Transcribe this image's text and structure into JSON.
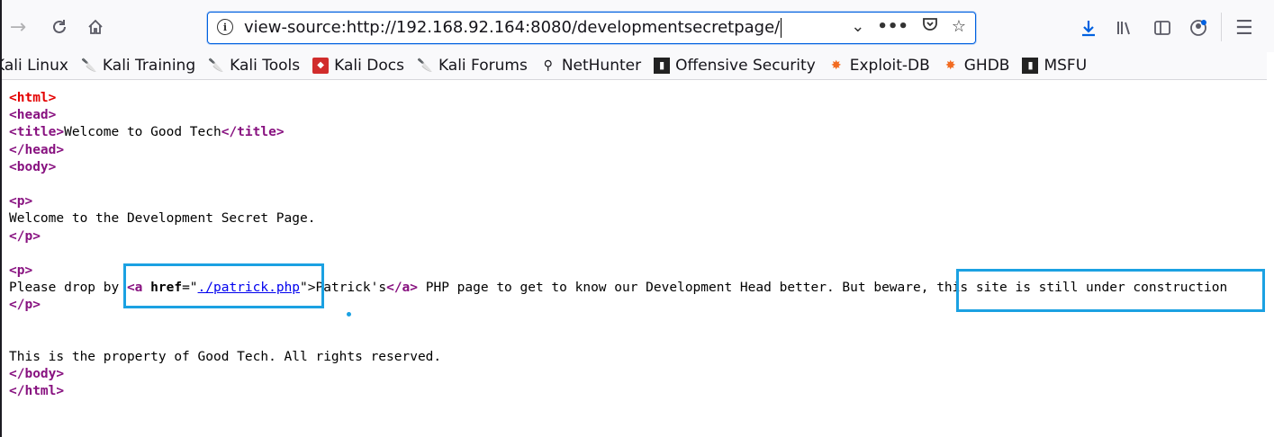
{
  "browser": {
    "url": "view-source:http://192.168.92.164:8080/developmentsecretpage/",
    "icons": {
      "back": "back-arrow-icon",
      "reload": "reload-icon",
      "home": "home-icon",
      "info": "info-icon",
      "dropdown": "chevron-down-icon",
      "more": "more-actions-icon",
      "pocket": "pocket-icon",
      "bookmark_star": "star-icon",
      "download": "download-icon",
      "library": "library-icon",
      "sidebar": "sidebar-icon",
      "account": "account-icon",
      "menu": "hamburger-menu-icon"
    },
    "accent": "#0061e0"
  },
  "bookmarks": [
    {
      "label": "Kali Linux",
      "icon": "kali-icon"
    },
    {
      "label": "Kali Training",
      "icon": "kali-dragon-icon"
    },
    {
      "label": "Kali Tools",
      "icon": "kali-dragon-icon"
    },
    {
      "label": "Kali Docs",
      "icon": "kali-docs-icon"
    },
    {
      "label": "Kali Forums",
      "icon": "kali-dragon-icon"
    },
    {
      "label": "NetHunter",
      "icon": "nethunter-icon"
    },
    {
      "label": "Offensive Security",
      "icon": "offsec-icon"
    },
    {
      "label": "Exploit-DB",
      "icon": "exploitdb-icon"
    },
    {
      "label": "GHDB",
      "icon": "exploitdb-icon"
    },
    {
      "label": "MSFU",
      "icon": "offsec-icon"
    }
  ],
  "source": {
    "html_open": "<html>",
    "head_open": "<head>",
    "title_open": "<title>",
    "title_text": "Welcome to Good Tech",
    "title_close": "</title>",
    "head_close": "</head>",
    "body_open": "<body>",
    "p_open": "<p>",
    "p1_text": "Welcome to the Development Secret Page.",
    "p_close": "</p>",
    "p2_prefix": "Please drop by ",
    "a_open_start": "<a ",
    "a_attr_name": "href",
    "a_attr_eq": "=\"",
    "a_href": "./patrick.php",
    "a_attr_end": "\">",
    "a_text": "Patrick's",
    "a_close": "</a>",
    "p2_suffix": " PHP page to get to know our Development Head better. But beware, ",
    "p2_highlight": "this site is still under construction",
    "footer_text": "This is the property of Good Tech. All rights reserved.",
    "body_close": "</body>",
    "html_close": "</html>"
  },
  "highlight_color": "#1ba1e2"
}
